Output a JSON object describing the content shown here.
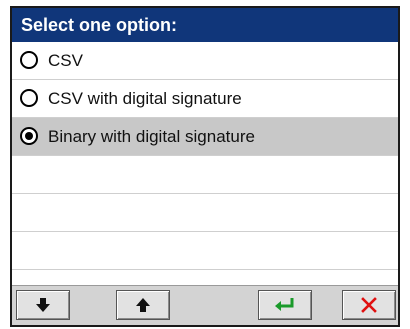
{
  "dialog": {
    "title": "Select one option:"
  },
  "options": [
    {
      "label": "CSV",
      "selected": false
    },
    {
      "label": "CSV with digital signature",
      "selected": false
    },
    {
      "label": "Binary with digital signature",
      "selected": true
    }
  ],
  "buttons": {
    "down": {
      "icon": "arrow-down-icon"
    },
    "up": {
      "icon": "arrow-up-icon"
    },
    "confirm": {
      "icon": "enter-arrow-icon",
      "color": "#1a9a2a"
    },
    "cancel": {
      "icon": "close-icon",
      "color": "#e01010"
    }
  },
  "colors": {
    "title_bar": "#10367a",
    "selected_row": "#c8c8c8"
  }
}
